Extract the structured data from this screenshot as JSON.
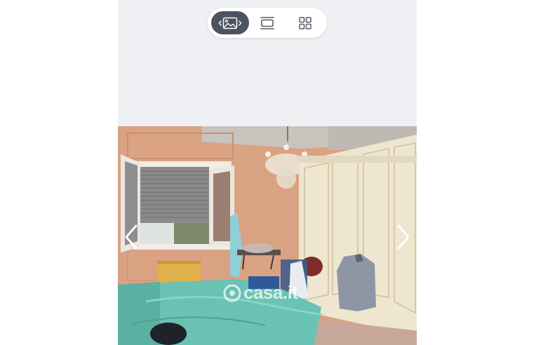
{
  "view_switcher": {
    "active": "gallery",
    "buttons": [
      {
        "id": "gallery",
        "icon": "image-gallery-icon"
      },
      {
        "id": "list",
        "icon": "list-view-icon"
      },
      {
        "id": "grid",
        "icon": "grid-view-icon"
      }
    ]
  },
  "photo": {
    "watermark": "casa.it",
    "prev_icon": "chevron-left-icon",
    "next_icon": "chevron-right-icon"
  },
  "colors": {
    "active_button": "#4b5260",
    "panel_background": "#eff0f4",
    "wall": "#d8a07e"
  }
}
